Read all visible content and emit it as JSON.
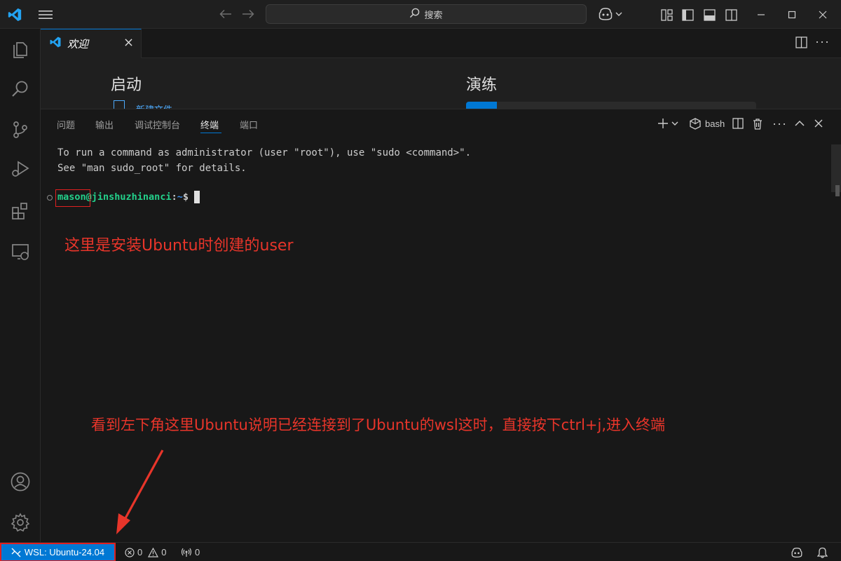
{
  "titlebar": {
    "search_placeholder": "搜索",
    "icons": [
      "vscode-logo-icon",
      "menu-icon",
      "back-icon",
      "forward-icon",
      "search-icon",
      "copilot-icon",
      "layout-icons",
      "minimize-icon",
      "maximize-icon",
      "close-icon"
    ]
  },
  "editor": {
    "tab_label": "欢迎"
  },
  "welcome": {
    "start_heading": "启动",
    "walkthrough_heading": "演练",
    "new_file_link": "新建文件..."
  },
  "panel": {
    "tabs": [
      "问题",
      "输出",
      "调试控制台",
      "终端",
      "端口"
    ],
    "active_tab": "终端",
    "shell_label": "bash"
  },
  "terminal": {
    "lines": [
      "To run a command as administrator (user \"root\"), use \"sudo <command>\".",
      "See \"man sudo_root\" for details."
    ],
    "prompt_user": "mason",
    "prompt_at": "@",
    "prompt_host": "jinshuzhinanci",
    "prompt_colon": ":",
    "prompt_path": "~",
    "prompt_dollar": "$"
  },
  "annotations": {
    "user_note": "这里是安装Ubuntu时创建的user",
    "wsl_note": "看到左下角这里Ubuntu说明已经连接到了Ubuntu的wsl这时，直接按下ctrl+j,进入终端",
    "color": "#e8352a"
  },
  "statusbar": {
    "remote_label": "WSL: Ubuntu-24.04",
    "errors": "0",
    "warnings": "0",
    "ports": "0",
    "accent": "#0078d4"
  }
}
